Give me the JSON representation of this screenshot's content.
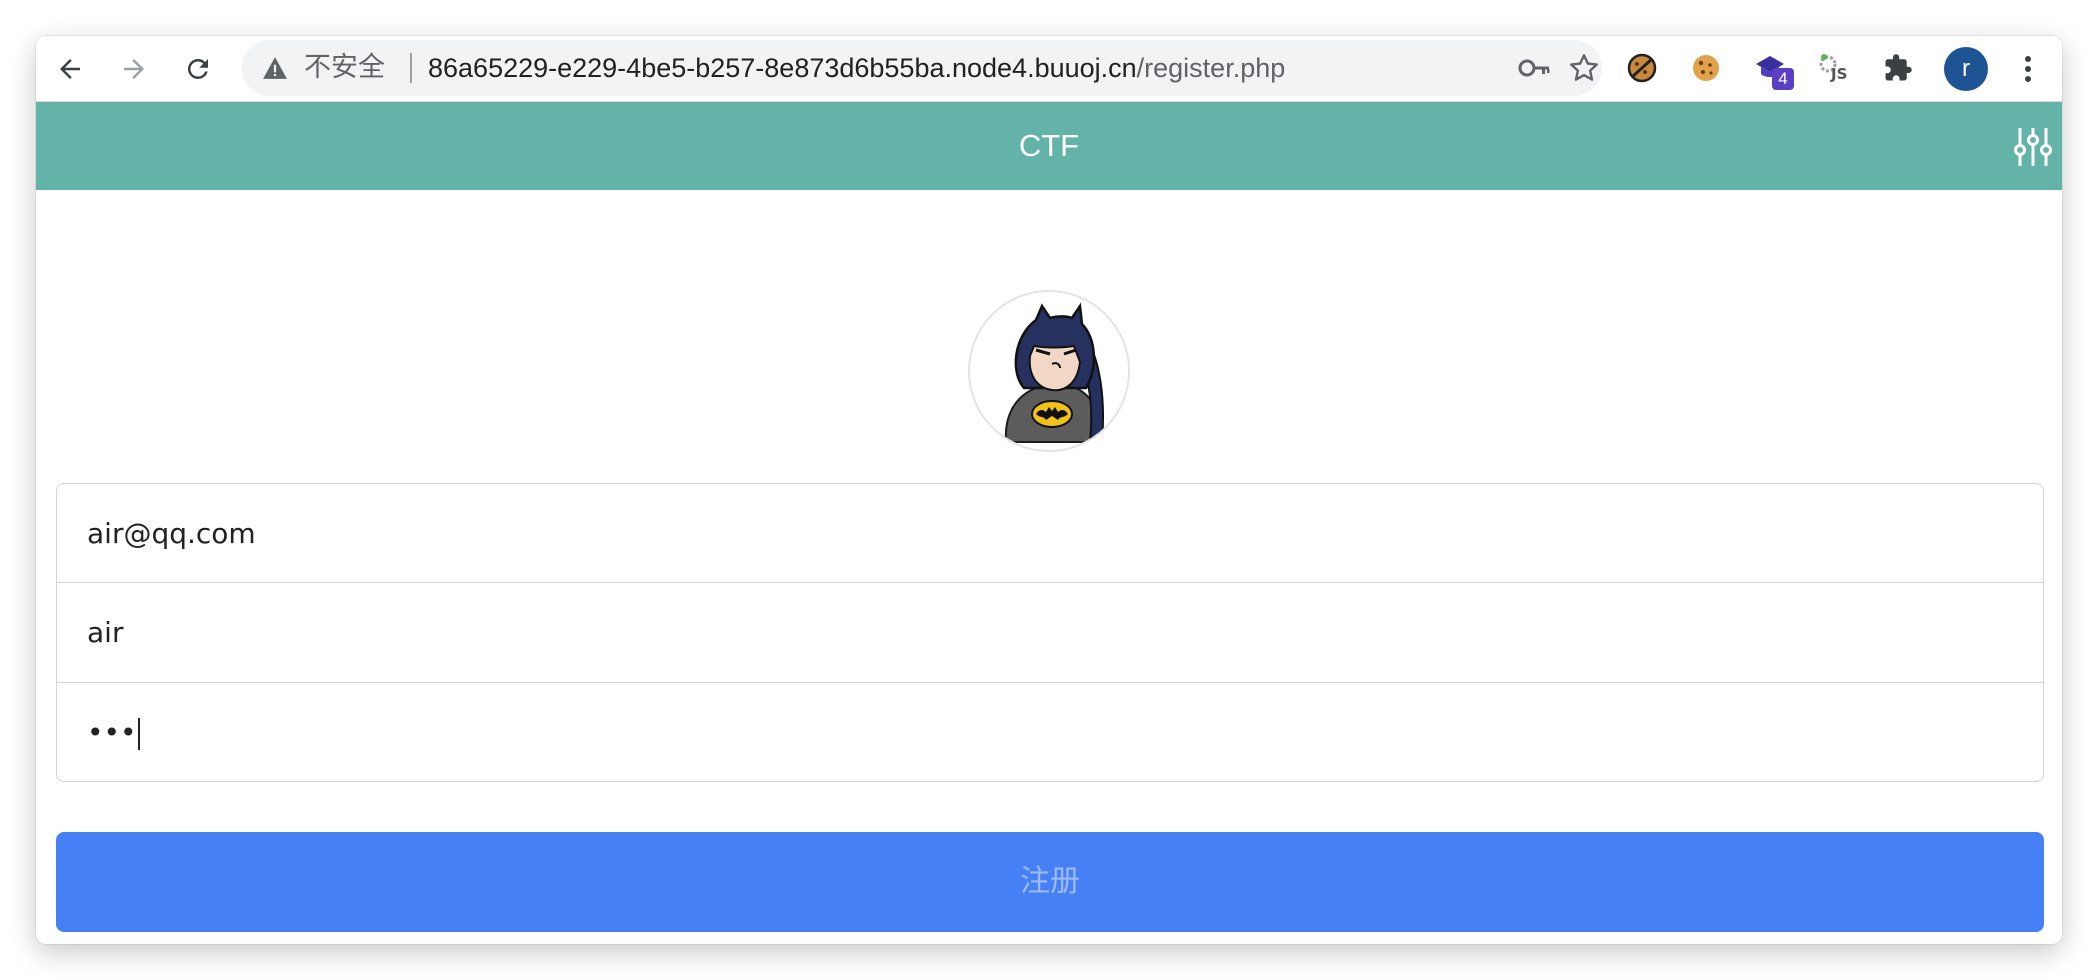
{
  "browser": {
    "security_label": "不安全",
    "url_host": "86a65229-e229-4be5-b257-8e873d6b55ba.node4.buuoj.cn",
    "url_path": "/register.php",
    "extension_badge": "4",
    "profile_initial": "r",
    "icons": [
      "back-arrow-icon",
      "forward-arrow-icon",
      "reload-icon",
      "warning-icon",
      "key-icon",
      "star-icon",
      "no-cookie-extension-icon",
      "cookie-extension-icon",
      "graduation-cap-extension-icon",
      "js-extension-icon",
      "puzzle-extensions-icon",
      "kebab-menu-icon"
    ]
  },
  "header": {
    "title": "CTF",
    "background": "#63b3a8",
    "settings_icon": "sliders-icon"
  },
  "form": {
    "email_value": "air@qq.com",
    "username_value": "air",
    "password_masked": "•••",
    "submit_label": "注册",
    "submit_color": "#4680f5"
  }
}
